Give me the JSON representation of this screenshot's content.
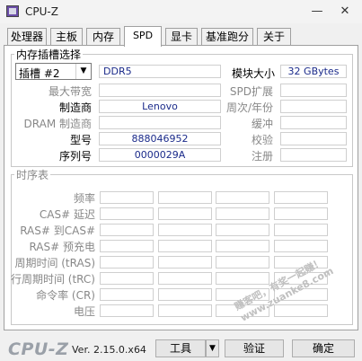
{
  "window": {
    "title": "CPU-Z",
    "minimize_icon": "minimize-icon",
    "close_icon": "close-icon",
    "minimize": "—",
    "close": "✕"
  },
  "tabs": [
    "处理器",
    "主板",
    "内存",
    "SPD",
    "显卡",
    "基准跑分",
    "关于"
  ],
  "active_tab": "SPD",
  "slot_group": {
    "title": "内存插槽选择",
    "slot": "插槽 #2",
    "memory_type": "DDR5",
    "labels": {
      "max_bandwidth": "最大带宽",
      "manufacturer": "制造商",
      "dram_manufacturer": "DRAM 制造商",
      "model": "型号",
      "serial": "序列号",
      "module_size": "模块大小",
      "spd_ext": "SPD扩展",
      "week_year": "周次/年份",
      "buffered": "缓冲",
      "correction": "校验",
      "registered": "注册"
    },
    "values": {
      "manufacturer": "Lenovo",
      "model": "888046952",
      "serial": "0000029A",
      "module_size": "32 GBytes"
    }
  },
  "timings": {
    "title": "时序表",
    "rows": [
      "频率",
      "CAS# 延迟",
      "RAS# 到CAS#",
      "RAS# 预充电",
      "周期时间 (tRAS)",
      "行周期时间 (tRC)",
      "命令率 (CR)",
      "电压"
    ]
  },
  "footer": {
    "logo": "CPU-Z",
    "version": "Ver. 2.15.0.x64",
    "tools": "工具",
    "validate": "验证",
    "ok": "确定"
  },
  "watermark": "赚客吧，有奖一起赚！ www.zuanke8.com"
}
